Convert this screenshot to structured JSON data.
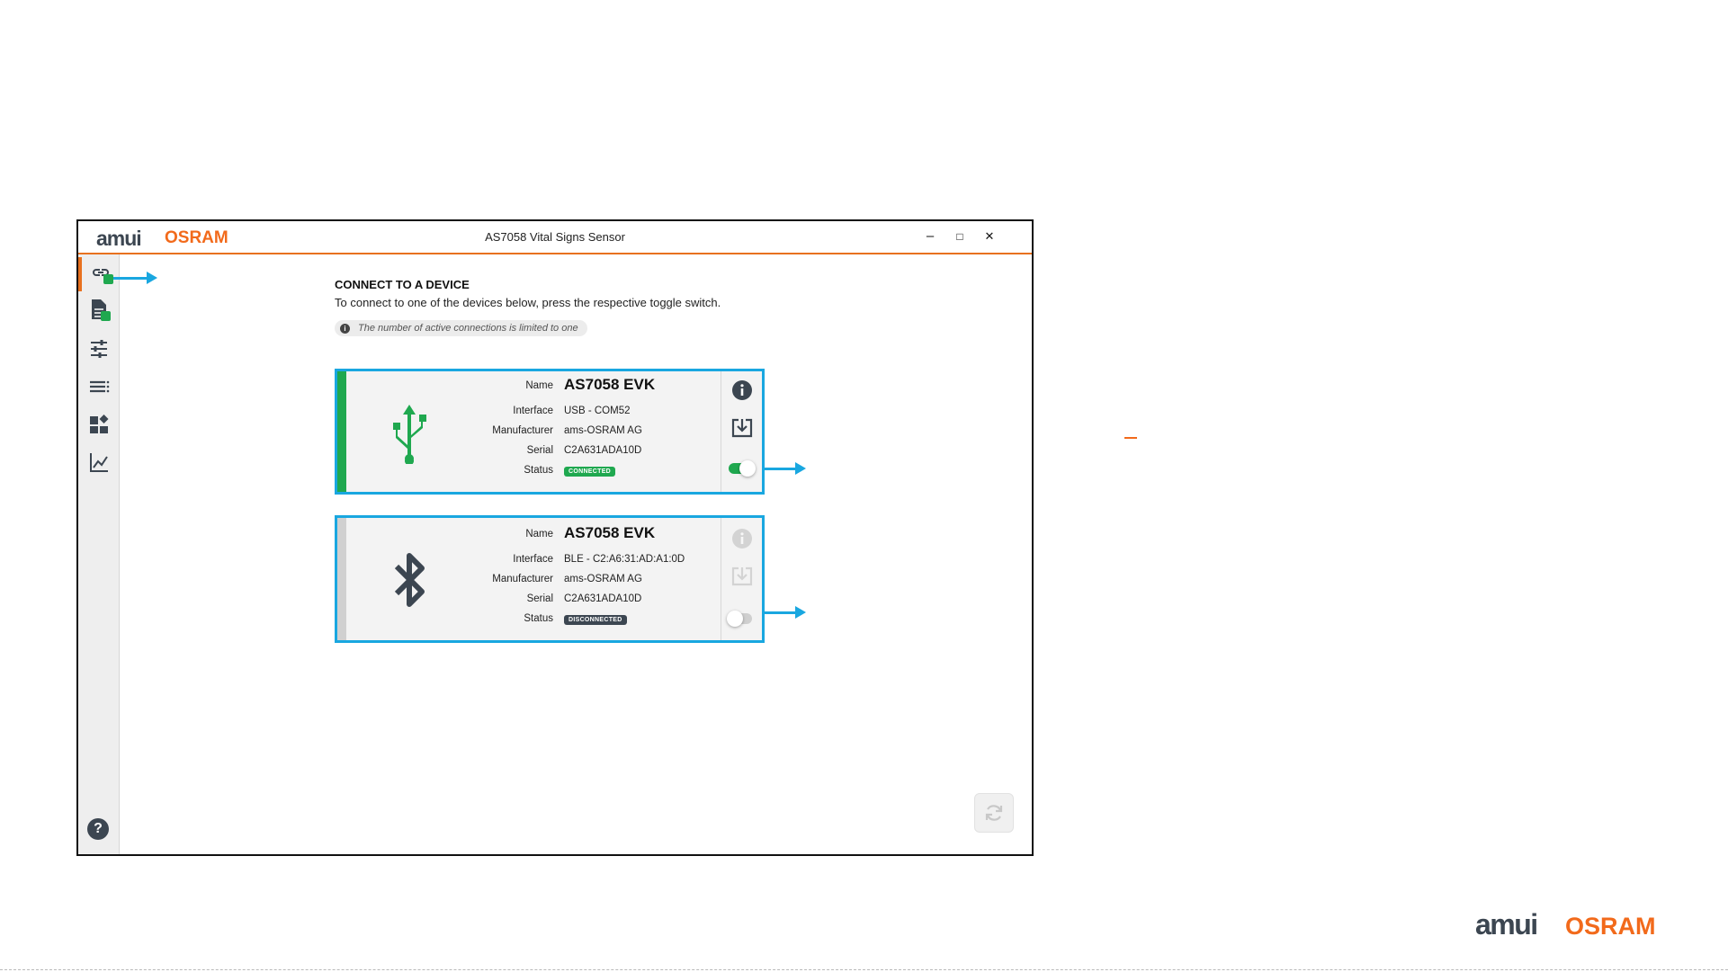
{
  "window": {
    "title": "AS7058 Vital Signs Sensor",
    "logo_am": "amui",
    "logo_osram": "OSRAM",
    "controls": {
      "minimize": "–",
      "maximize": "□",
      "close": "✕"
    }
  },
  "sidebar": {
    "items": [
      {
        "icon": "link-icon",
        "active": true,
        "checked": true
      },
      {
        "icon": "document-icon",
        "active": false,
        "checked": true
      },
      {
        "icon": "sliders-icon",
        "active": false,
        "checked": false
      },
      {
        "icon": "list-icon",
        "active": false,
        "checked": false
      },
      {
        "icon": "widgets-icon",
        "active": false,
        "checked": false
      },
      {
        "icon": "chart-icon",
        "active": false,
        "checked": false
      }
    ],
    "help_label": "?"
  },
  "main": {
    "heading": "CONNECT TO A DEVICE",
    "subheading": "To connect to one of the devices below, press the respective toggle switch.",
    "note_icon": "i",
    "note": "The number of active connections is limited to one",
    "labels": {
      "name": "Name",
      "interface": "Interface",
      "manufacturer": "Manufacturer",
      "serial": "Serial",
      "status": "Status"
    },
    "devices": [
      {
        "icon": "usb-icon",
        "name": "AS7058 EVK",
        "interface": "USB - COM52",
        "manufacturer": "ams-OSRAM AG",
        "serial": "C2A631ADA10D",
        "status": "CONNECTED",
        "connected": true
      },
      {
        "icon": "bluetooth-icon",
        "name": "AS7058 EVK",
        "interface": "BLE - C2:A6:31:AD:A1:0D",
        "manufacturer": "ams-OSRAM AG",
        "serial": "C2A631ADA10D",
        "status": "DISCONNECTED",
        "connected": false
      }
    ]
  },
  "footer": {
    "brand_am": "amui",
    "brand_osram": "OSRAM"
  },
  "colors": {
    "accent_orange": "#f26a1b",
    "highlight_blue": "#19a7e0",
    "connected_green": "#1fa84f",
    "disconnected_gray": "#3c4651"
  }
}
